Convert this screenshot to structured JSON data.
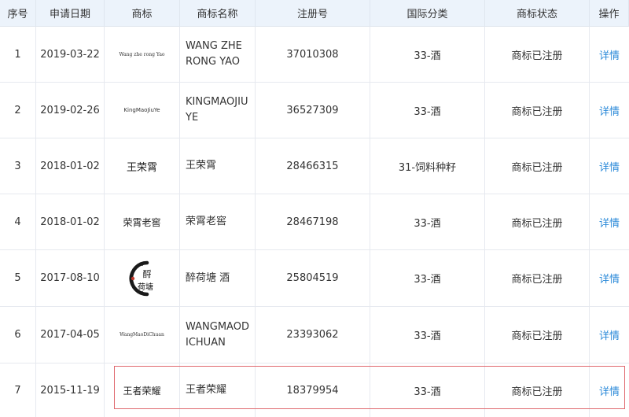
{
  "columns": [
    "序号",
    "申请日期",
    "商标",
    "商标名称",
    "注册号",
    "国际分类",
    "商标状态",
    "操作"
  ],
  "rows": [
    {
      "index": "1",
      "date": "2019-03-22",
      "logo_text": "Wang zhe rong Yao",
      "name": "WANG ZHE RONG YAO",
      "reg": "37010308",
      "class": "33-酒",
      "status": "商标已注册",
      "action": "详情"
    },
    {
      "index": "2",
      "date": "2019-02-26",
      "logo_text": "KingMaoJiuYe",
      "name": "KINGMAOJIUYE",
      "reg": "36527309",
      "class": "33-酒",
      "status": "商标已注册",
      "action": "详情"
    },
    {
      "index": "3",
      "date": "2018-01-02",
      "logo_text": "王荣霄",
      "name": "王荣霄",
      "reg": "28466315",
      "class": "31-饲料种籽",
      "status": "商标已注册",
      "action": "详情"
    },
    {
      "index": "4",
      "date": "2018-01-02",
      "logo_text": "荣霄老窖",
      "name": "荣霄老窖",
      "reg": "28467198",
      "class": "33-酒",
      "status": "商标已注册",
      "action": "详情"
    },
    {
      "index": "5",
      "date": "2017-08-10",
      "logo_text": "醉荷塘",
      "name": "醉荷塘 酒",
      "reg": "25804519",
      "class": "33-酒",
      "status": "商标已注册",
      "action": "详情"
    },
    {
      "index": "6",
      "date": "2017-04-05",
      "logo_text": "WangMaoDiChuan",
      "name": "WANGMAODICHUAN",
      "reg": "23393062",
      "class": "33-酒",
      "status": "商标已注册",
      "action": "详情"
    },
    {
      "index": "7",
      "date": "2015-11-19",
      "logo_text": "王者荣耀",
      "name": "王者荣耀",
      "reg": "18379954",
      "class": "33-酒",
      "status": "商标已注册",
      "action": "详情"
    }
  ],
  "highlighted_row": "7",
  "colors": {
    "header_bg": "#ecf3fb",
    "link": "#2b8ad9",
    "highlight_border": "#e06a70"
  }
}
